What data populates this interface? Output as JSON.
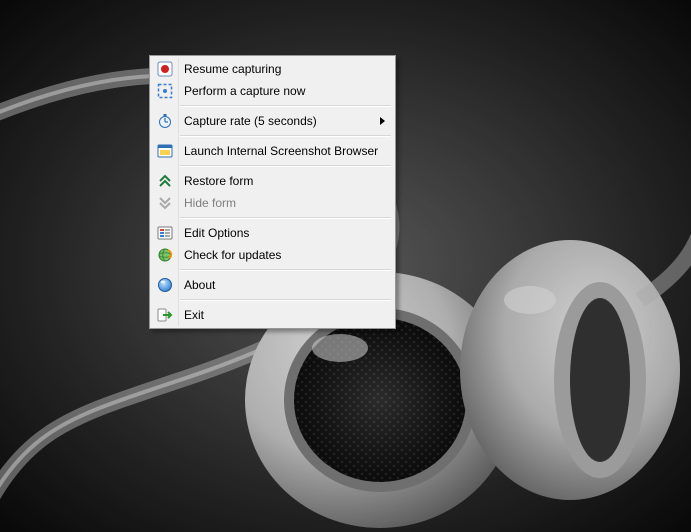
{
  "menu": {
    "items": [
      {
        "label": "Resume capturing"
      },
      {
        "label": "Perform a capture now"
      },
      {
        "label": "Capture rate (5 seconds)"
      },
      {
        "label": "Launch Internal Screenshot Browser"
      },
      {
        "label": "Restore form"
      },
      {
        "label": "Hide form"
      },
      {
        "label": "Edit Options"
      },
      {
        "label": "Check for updates"
      },
      {
        "label": "About"
      },
      {
        "label": "Exit"
      }
    ]
  }
}
